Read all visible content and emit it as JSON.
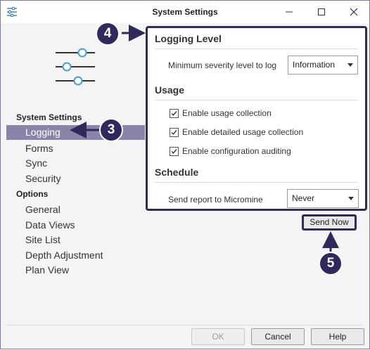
{
  "window": {
    "title": "System Settings"
  },
  "nav": {
    "section1_heading": "System Settings",
    "section1_items": [
      "Logging",
      "Forms",
      "Sync",
      "Security"
    ],
    "section2_heading": "Options",
    "section2_items": [
      "General",
      "Data Views",
      "Site List",
      "Depth Adjustment",
      "Plan View"
    ]
  },
  "logging": {
    "title": "Logging Level",
    "min_severity_label": "Minimum severity level to log",
    "min_severity_value": "Information"
  },
  "usage": {
    "title": "Usage",
    "checks": [
      {
        "label": "Enable usage collection",
        "checked": true
      },
      {
        "label": "Enable detailed usage collection",
        "checked": true
      },
      {
        "label": "Enable configuration auditing",
        "checked": true
      }
    ]
  },
  "schedule": {
    "title": "Schedule",
    "send_report_label": "Send report to Micromine",
    "send_report_value": "Never"
  },
  "send_now_label": "Send Now",
  "buttons": {
    "ok": "OK",
    "cancel": "Cancel",
    "help": "Help"
  },
  "callouts": {
    "c3": "3",
    "c4": "4",
    "c5": "5"
  },
  "colors": {
    "accent": "#2e2a5c",
    "selection": "#8a84a8",
    "icon_blue": "#4a9fd0"
  },
  "icons": {
    "app": "sliders-icon",
    "hero": "sliders-icon"
  }
}
